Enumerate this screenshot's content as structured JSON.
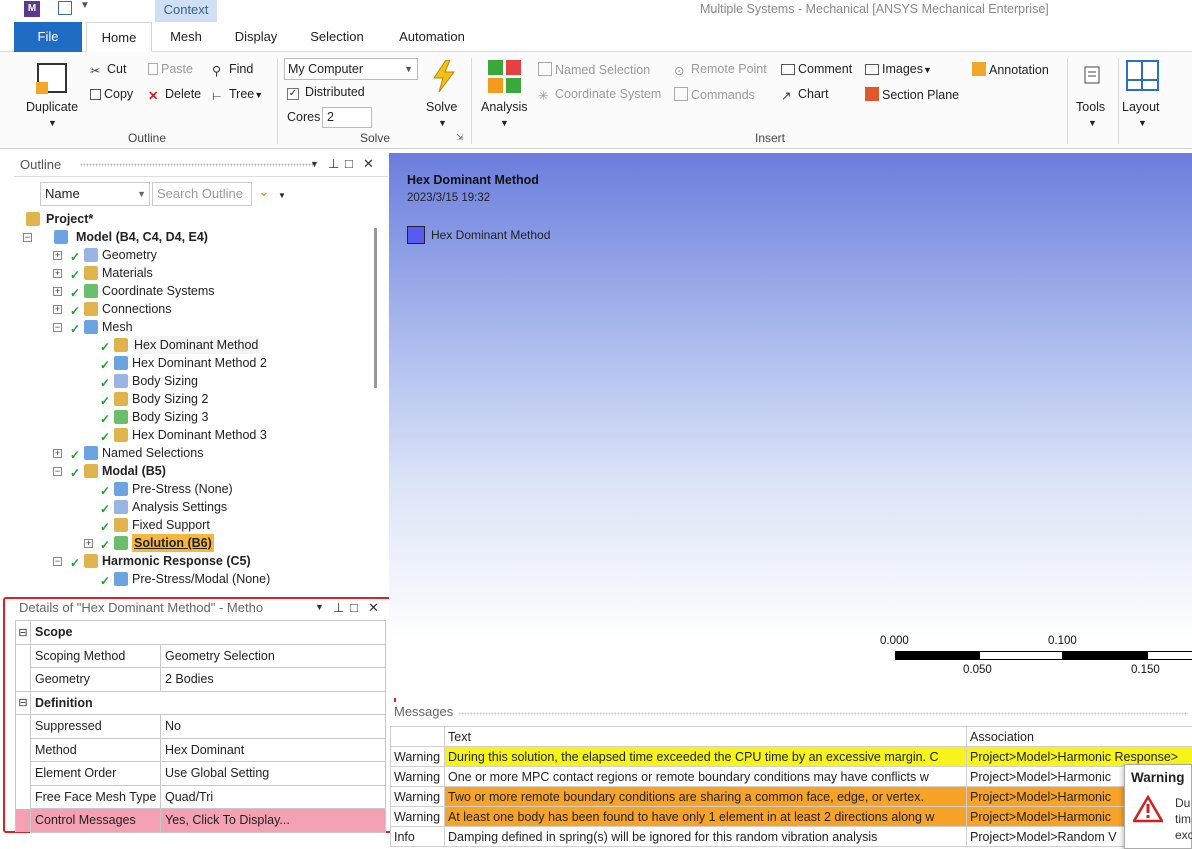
{
  "window": {
    "title": "Multiple Systems - Mechanical [ANSYS Mechanical Enterprise]",
    "context_tab": "Context",
    "app_icon_letter": "M"
  },
  "ribbon_tabs": [
    "File",
    "Home",
    "Mesh",
    "Display",
    "Selection",
    "Automation"
  ],
  "ribbon": {
    "outline": {
      "duplicate": "Duplicate",
      "cut": "Cut",
      "copy": "Copy",
      "paste": "Paste",
      "delete": "Delete",
      "find": "Find",
      "tree": "Tree",
      "label": "Outline"
    },
    "solve": {
      "computer": "My Computer",
      "distributed": "Distributed",
      "cores_label": "Cores",
      "cores_value": "2",
      "solve_button": "Solve",
      "label": "Solve"
    },
    "insert": {
      "analysis": "Analysis",
      "named_selection": "Named Selection",
      "coordinate_system": "Coordinate System",
      "remote_point": "Remote Point",
      "commands": "Commands",
      "comment": "Comment",
      "chart": "Chart",
      "images": "Images",
      "section_plane": "Section Plane",
      "annotation": "Annotation",
      "label": "Insert"
    },
    "tools": "Tools",
    "layout": "Layout"
  },
  "outline": {
    "title": "Outline",
    "name_filter": "Name",
    "search_placeholder": "Search Outline",
    "tree": [
      {
        "label": "Project*",
        "bold": true,
        "depth": 0
      },
      {
        "label": "Model (B4, C4, D4, E4)",
        "bold": true,
        "depth": 1
      },
      {
        "label": "Geometry",
        "depth": 2
      },
      {
        "label": "Materials",
        "depth": 2
      },
      {
        "label": "Coordinate Systems",
        "depth": 2
      },
      {
        "label": "Connections",
        "depth": 2
      },
      {
        "label": "Mesh",
        "depth": 2
      },
      {
        "label": "Hex Dominant Method",
        "depth": 3,
        "selected": true
      },
      {
        "label": "Hex Dominant Method 2",
        "depth": 3
      },
      {
        "label": "Body Sizing",
        "depth": 3
      },
      {
        "label": "Body Sizing 2",
        "depth": 3
      },
      {
        "label": "Body Sizing 3",
        "depth": 3
      },
      {
        "label": "Hex Dominant Method 3",
        "depth": 3
      },
      {
        "label": "Named Selections",
        "depth": 2
      },
      {
        "label": "Modal (B5)",
        "bold": true,
        "depth": 2
      },
      {
        "label": "Pre-Stress (None)",
        "depth": 3
      },
      {
        "label": "Analysis Settings",
        "depth": 3
      },
      {
        "label": "Fixed Support",
        "depth": 3
      },
      {
        "label": "Solution (B6)",
        "depth": 3,
        "highlight": true
      },
      {
        "label": "Harmonic Response (C5)",
        "bold": true,
        "depth": 2
      },
      {
        "label": "Pre-Stress/Modal (None)",
        "depth": 3
      }
    ]
  },
  "details": {
    "title": "Details of \"Hex Dominant Method\" - Metho",
    "groups": [
      {
        "name": "Scope",
        "rows": [
          {
            "key": "Scoping Method",
            "value": "Geometry Selection"
          },
          {
            "key": "Geometry",
            "value": "2 Bodies"
          }
        ]
      },
      {
        "name": "Definition",
        "rows": [
          {
            "key": "Suppressed",
            "value": "No"
          },
          {
            "key": "Method",
            "value": "Hex Dominant"
          },
          {
            "key": "Element Order",
            "value": "Use Global Setting"
          },
          {
            "key": "Free Face Mesh Type",
            "value": "Quad/Tri"
          },
          {
            "key": "Control Messages",
            "value": "Yes, Click To Display..."
          }
        ]
      }
    ]
  },
  "viewport": {
    "title": "Hex Dominant Method",
    "date": "2023/3/15 19:32",
    "legend_label": "Hex Dominant Method",
    "legend_color": "#5a5af0",
    "scale_top": [
      "0.000",
      "0.100"
    ],
    "scale_bottom": [
      "0.050",
      "0.150"
    ]
  },
  "messages": {
    "title": "Messages",
    "columns": [
      "",
      "Text",
      "Association"
    ],
    "rows": [
      {
        "type": "Warning",
        "text": "During this solution, the elapsed time exceeded the CPU time by an excessive margin. C",
        "assoc": "Project>Model>Harmonic Response>",
        "color": "yellow"
      },
      {
        "type": "Warning",
        "text": "One or more MPC contact regions or remote boundary conditions may have conflicts w",
        "assoc": "Project>Model>Harmonic",
        "color": "none"
      },
      {
        "type": "Warning",
        "text": "Two or more remote boundary conditions are sharing a common face, edge, or vertex.",
        "assoc": "Project>Model>Harmonic",
        "color": "orange"
      },
      {
        "type": "Warning",
        "text": "At least one body has been found to have only 1 element in at least 2 directions along w",
        "assoc": "Project>Model>Harmonic",
        "color": "orange"
      },
      {
        "type": "Info",
        "text": "Damping defined in spring(s) will be ignored for this random vibration analysis",
        "assoc": "Project>Model>Random V",
        "color": "none"
      }
    ]
  },
  "warning_popup": {
    "title": "Warning",
    "text_lines": [
      "Du",
      "tim",
      "exc"
    ]
  }
}
